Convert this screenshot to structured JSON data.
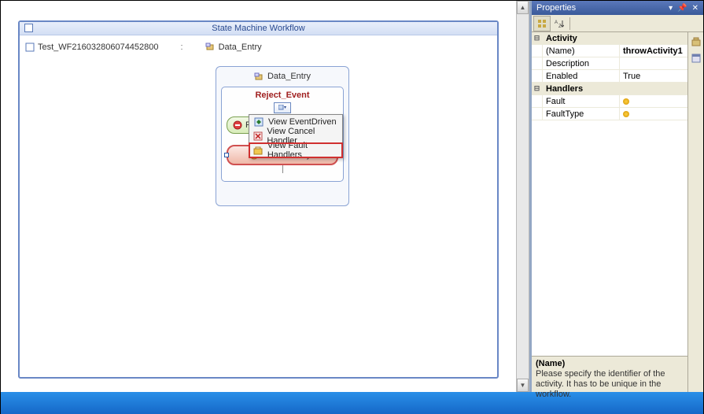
{
  "canvas": {
    "title": "State Machine Workflow"
  },
  "breadcrumb": [
    {
      "label": "Test_WF216032806074452800"
    },
    {
      "label": "Data_Entry"
    }
  ],
  "bc_sep": ":",
  "state": {
    "title": "Data_Entry"
  },
  "event": {
    "title": "Reject_Event"
  },
  "activity_reject": {
    "label": "Rejec"
  },
  "activity_throw": {
    "label": "throwActivity1"
  },
  "menu": {
    "items": [
      {
        "label": "View EventDriven",
        "icon": "event-icon"
      },
      {
        "label": "View Cancel Handler",
        "icon": "cancel-icon"
      },
      {
        "label": "View Fault Handlers",
        "icon": "fault-icon"
      }
    ]
  },
  "properties": {
    "title": "Properties",
    "categories": {
      "activity": {
        "name": "Activity",
        "rows": [
          {
            "key": "(Name)",
            "val": "throwActivity1",
            "bold": true
          },
          {
            "key": "Description",
            "val": ""
          },
          {
            "key": "Enabled",
            "val": "True"
          }
        ]
      },
      "handlers": {
        "name": "Handlers",
        "rows": [
          {
            "key": "Fault",
            "val": "",
            "nullind": true
          },
          {
            "key": "FaultType",
            "val": "",
            "nullind": true
          }
        ]
      }
    },
    "desc": {
      "title": "(Name)",
      "text": "Please specify the identifier of the activity. It has to be unique in the workflow."
    }
  }
}
